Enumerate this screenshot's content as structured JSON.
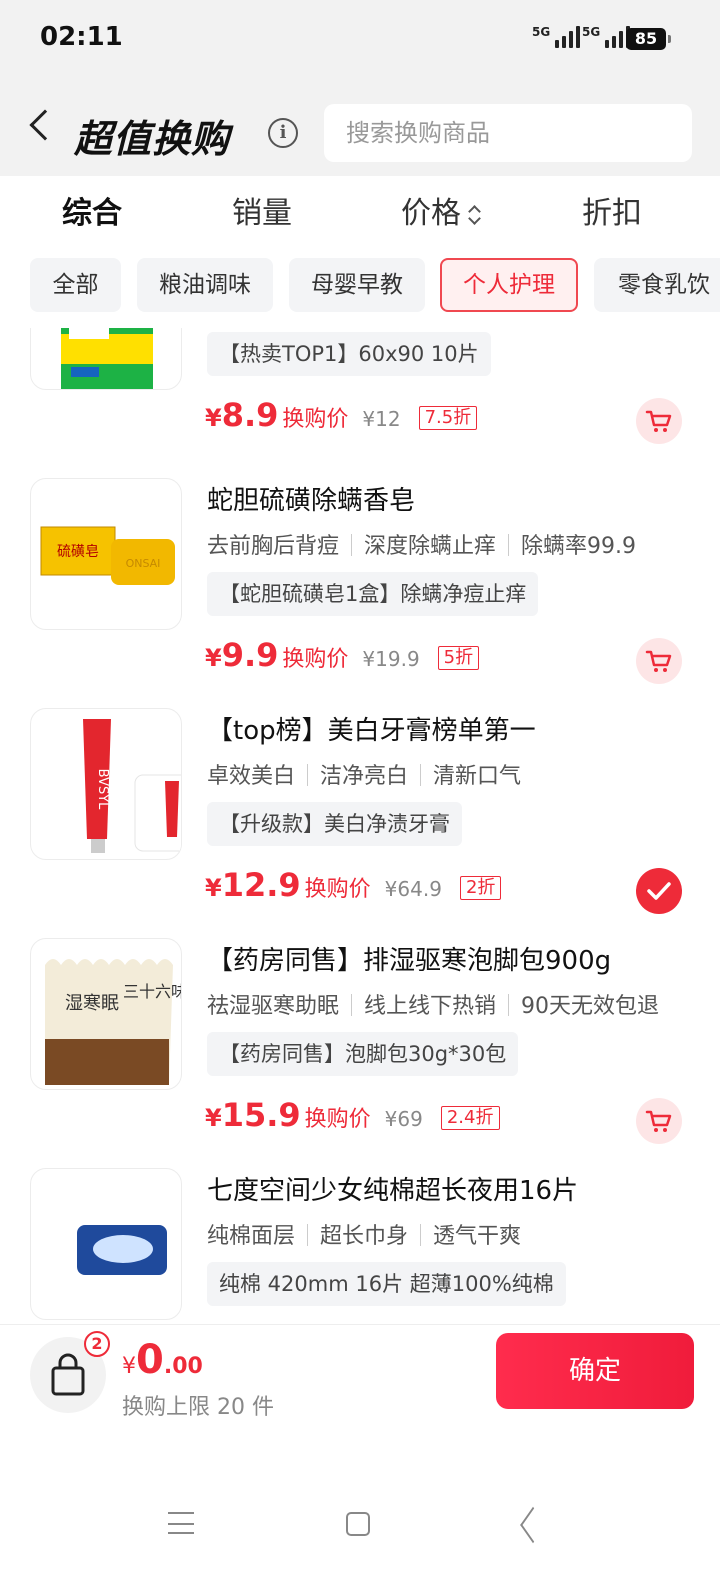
{
  "status": {
    "time": "02:11",
    "sig1": "5G",
    "sig2": "5G",
    "battery": "85"
  },
  "header": {
    "title": "超值换购",
    "info_icon": "info-icon",
    "search_placeholder": "搜索换购商品"
  },
  "sort_tabs": [
    {
      "label": "综合",
      "active": true
    },
    {
      "label": "销量"
    },
    {
      "label": "价格"
    },
    {
      "label": "折扣"
    }
  ],
  "categories": [
    "全部",
    "粮油调味",
    "母婴早教",
    "个人护理",
    "零食乳饮"
  ],
  "active_category": "个人护理",
  "items": [
    {
      "name": "",
      "tags": [],
      "promo": "【热卖TOP1】60x90 10片",
      "currency": "¥",
      "price": "8.9",
      "price_label": "换购价",
      "orig": "¥12",
      "discount": "7.5折",
      "selected": false
    },
    {
      "name": "蛇胆硫磺除螨香皂",
      "tags": [
        "去前胸后背痘",
        "深度除螨止痒",
        "除螨率99.9"
      ],
      "promo": "【蛇胆硫磺皂1盒】除螨净痘止痒",
      "currency": "¥",
      "price": "9.9",
      "price_label": "换购价",
      "orig": "¥19.9",
      "discount": "5折",
      "selected": false
    },
    {
      "name": "【top榜】美白牙膏榜单第一",
      "tags": [
        "卓效美白",
        "洁净亮白",
        "清新口气"
      ],
      "promo": "【升级款】美白净渍牙膏",
      "currency": "¥",
      "price": "12.9",
      "price_label": "换购价",
      "orig": "¥64.9",
      "discount": "2折",
      "selected": true
    },
    {
      "name": "【药房同售】排湿驱寒泡脚包900g",
      "tags": [
        "祛湿驱寒助眠",
        "线上线下热销",
        "90天无效包退"
      ],
      "promo": "【药房同售】泡脚包30g*30包",
      "currency": "¥",
      "price": "15.9",
      "price_label": "换购价",
      "orig": "¥69",
      "discount": "2.4折",
      "selected": false
    },
    {
      "name": "七度空间少女纯棉超长夜用16片",
      "tags": [
        "纯棉面层",
        "超长巾身",
        "透气干爽"
      ],
      "promo": "纯棉 420mm 16片 超薄100%纯棉",
      "currency": "",
      "price": "",
      "price_label": "",
      "orig": "",
      "discount": "",
      "selected": false
    }
  ],
  "product_art": {
    "soap_text": "ONSAI",
    "soap_box_text": "硫磺皂",
    "toothpaste_text": "BVSYL",
    "footbath_text": "三十六味",
    "footbath_text2": "湿寒眠"
  },
  "bottom": {
    "badge": "2",
    "currency": "¥",
    "total_int": "0",
    "total_dec": ".00",
    "limit": "换购上限 20 件",
    "confirm": "确定"
  },
  "colors": {
    "accent": "#ee2b39",
    "bg": "#f2f2f2"
  }
}
